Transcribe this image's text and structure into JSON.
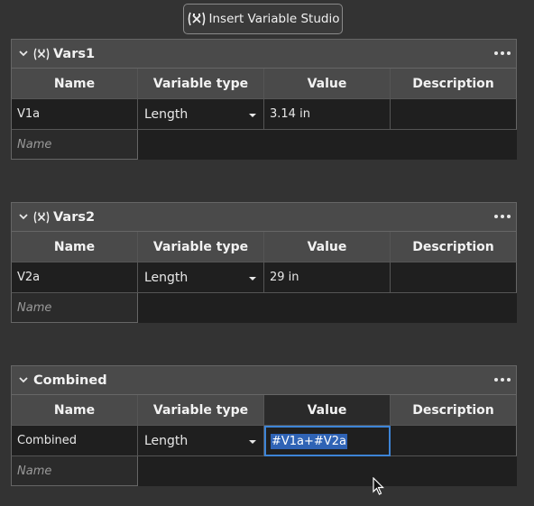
{
  "insert_button": {
    "label": "Insert Variable Studio",
    "icon": "variable-studio-icon"
  },
  "columns": {
    "name": "Name",
    "type": "Variable type",
    "value": "Value",
    "description": "Description"
  },
  "tables": [
    {
      "title": "Vars1",
      "has_icon": true,
      "rows": [
        {
          "name": "V1a",
          "type": "Length",
          "value": "3.14 in",
          "description": ""
        }
      ],
      "add_placeholder": "Name"
    },
    {
      "title": "Vars2",
      "has_icon": true,
      "rows": [
        {
          "name": "V2a",
          "type": "Length",
          "value": "29 in",
          "description": ""
        }
      ],
      "add_placeholder": "Name"
    },
    {
      "title": "Combined",
      "has_icon": false,
      "rows": [
        {
          "name": "Combined",
          "type": "Length",
          "value": "#V1a+#V2a",
          "description": ""
        }
      ],
      "add_placeholder": "Name"
    }
  ],
  "colors": {
    "accent": "#3d84d6",
    "selection": "#2f63b5",
    "background": "#333333"
  }
}
